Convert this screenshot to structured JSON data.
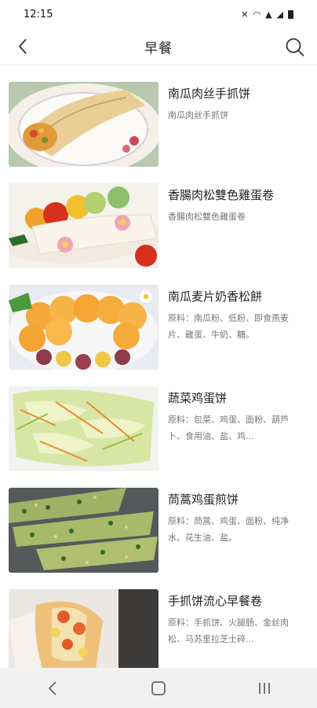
{
  "status_bar": {
    "time": "12:15"
  },
  "header": {
    "title": "早餐"
  },
  "recipes": [
    {
      "name": "南瓜肉丝手抓饼",
      "desc": "南瓜肉丝手抓饼",
      "image": "wrap-with-vegetables"
    },
    {
      "name": "香腸肉松雙色雞蛋卷",
      "desc": "香腸肉松雙色雞蛋卷",
      "image": "egg-roll-with-tomatoes"
    },
    {
      "name": "南瓜麦片奶香松餅",
      "desc": "原料：南瓜粉、低粉、即食燕麦片、雞蛋、牛奶、糖。",
      "image": "pumpkin-pancakes"
    },
    {
      "name": "蔬菜鸡蛋饼",
      "desc": "原料：包菜、鸡蛋、面粉、葫芦卜、食用油、盐、鸡...",
      "image": "vegetable-egg-pancake"
    },
    {
      "name": "茼蒿鸡蛋煎饼",
      "desc": "原料：茼蒿、鸡蛋、面粉、纯净水、花生油、盐。",
      "image": "green-egg-pancake"
    },
    {
      "name": "手抓饼流心早餐卷",
      "desc": "原料：手抓饼、火腿肠、金丝肉松、马苏里拉芝士碎...",
      "image": "breakfast-roll"
    }
  ]
}
